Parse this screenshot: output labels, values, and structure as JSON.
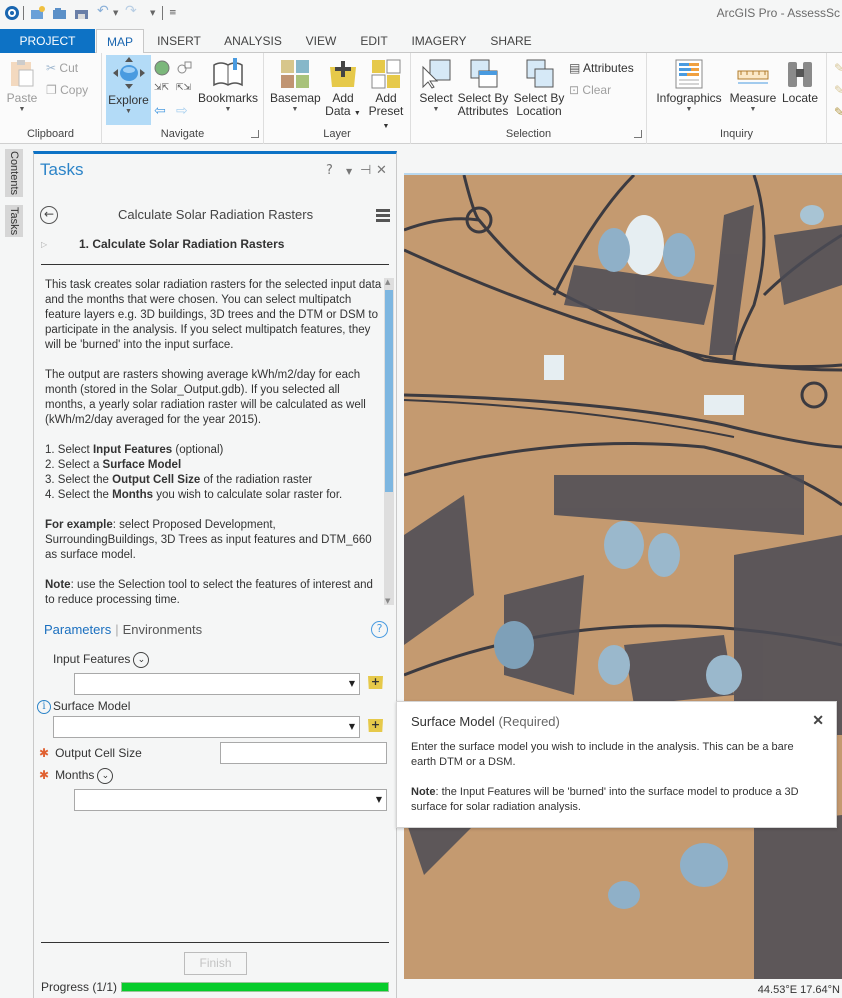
{
  "app": {
    "title": "ArcGIS Pro - AssessSc"
  },
  "quick_access": {
    "icons": [
      "arcgis-pro-logo-icon",
      "new-project-icon",
      "open-project-icon",
      "save-project-icon",
      "undo-icon",
      "redo-icon",
      "customize-qat-icon"
    ]
  },
  "ribbon": {
    "tabs": [
      {
        "label": "PROJECT"
      },
      {
        "label": "MAP"
      },
      {
        "label": "INSERT"
      },
      {
        "label": "ANALYSIS"
      },
      {
        "label": "VIEW"
      },
      {
        "label": "EDIT"
      },
      {
        "label": "IMAGERY"
      },
      {
        "label": "SHARE"
      }
    ],
    "active_tab": "MAP",
    "groups": {
      "clipboard": {
        "label": "Clipboard",
        "paste": "Paste",
        "cut": "Cut",
        "copy": "Copy"
      },
      "navigate": {
        "label": "Navigate",
        "explore": "Explore",
        "bookmarks": "Bookmarks"
      },
      "layer": {
        "label": "Layer",
        "basemap": "Basemap",
        "add_data_1": "Add",
        "add_data_2": "Data",
        "add_preset_1": "Add",
        "add_preset_2": "Preset"
      },
      "selection": {
        "label": "Selection",
        "select": "Select",
        "select_by_attr_1": "Select By",
        "select_by_attr_2": "Attributes",
        "select_by_loc_1": "Select By",
        "select_by_loc_2": "Location",
        "attributes": "Attributes",
        "clear": "Clear"
      },
      "inquiry": {
        "label": "Inquiry",
        "infographics": "Infographics",
        "measure": "Measure",
        "locate": "Locate"
      }
    }
  },
  "side_dock": {
    "contents": "Contents",
    "tasks": "Tasks"
  },
  "tasks_pane": {
    "title": "Tasks",
    "help": "?",
    "task_name": "Calculate Solar Radiation Rasters",
    "step_title": "1.  Calculate Solar Radiation Rasters",
    "description": {
      "p1": "This task creates solar radiation rasters for the selected input data and the months that were chosen. You can select multipatch feature layers e.g. 3D buildings, 3D trees and the DTM or DSM to participate in the analysis. If you select multipatch features, they will be 'burned' into the input surface.",
      "p2": "The output are rasters showing average kWh/m2/day for each month (stored in the Solar_Output.gdb). If you selected all months, a yearly solar radiation raster will be calculated as well (kWh/m2/day averaged for the year 2015).",
      "steps": [
        {
          "pre": "1. Select ",
          "bold": "Input Features",
          "post": " (optional)"
        },
        {
          "pre": "2. Select a ",
          "bold": "Surface Model",
          "post": ""
        },
        {
          "pre": "3. Select the ",
          "bold": "Output Cell Size",
          "post": " of the radiation raster"
        },
        {
          "pre": "4. Select the ",
          "bold": "Months",
          "post": " you wish to calculate solar raster for."
        }
      ],
      "example_bold": "For example",
      "example_text": ": select Proposed Development, SurroundingBuildings, 3D Trees as input features and DTM_660 as surface model.",
      "note_bold": "Note",
      "note_text": ": use the Selection tool to select the features of interest and to reduce processing time."
    },
    "tabs": {
      "parameters": "Parameters",
      "environments": "Environments"
    },
    "parameters": {
      "input_features": {
        "label": "Input Features",
        "value": ""
      },
      "surface_model": {
        "label": "Surface Model",
        "value": ""
      },
      "output_cell_size": {
        "label": "Output Cell Size",
        "value": ""
      },
      "months": {
        "label": "Months",
        "value": ""
      }
    },
    "finish": "Finish",
    "progress": {
      "label": "Progress (1/1)",
      "fraction": 1.0
    }
  },
  "popup": {
    "title": "Surface Model",
    "required": "(Required)",
    "body": "Enter the surface model you wish to include in the analysis. This can be a bare earth DTM or a DSM.",
    "note_bold": "Note",
    "note_text": ": the Input Features will be 'burned' into the surface model to produce a 3D surface for solar radiation analysis."
  },
  "status": {
    "coordinates": "44.53°E 17.64°N"
  },
  "colors": {
    "accent": "#0d72c5",
    "progress": "#06cc2a",
    "required": "#e06030",
    "link": "#2c84c8"
  }
}
